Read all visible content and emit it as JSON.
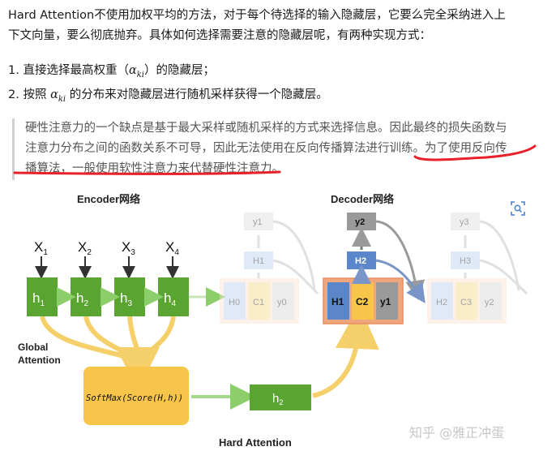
{
  "intro": {
    "line1": "Hard Attention不使用加权平均的方法，对于每个待选择的输入隐藏层，它要么完全采纳进入上",
    "line2": "下文向量，要么彻底抛弃。具体如何选择需要注意的隐藏层呢，有两种实现方式："
  },
  "list": {
    "item1_pre": "1. 直接选择最高权重（",
    "item1_math_base": "α",
    "item1_math_sub": "ki",
    "item1_post": "）的隐藏层；",
    "item2_pre": "2. 按照 ",
    "item2_math_base": "α",
    "item2_math_sub": "ki",
    "item2_post": " 的分布来对隐藏层进行随机采样获得一个隐藏层。"
  },
  "quote": {
    "line1": "硬性注意力的一个缺点是基于最大采样或随机采样的方式来选择信息。因此最终的损失函数与",
    "line2_a": "注意力分布之间的函数关系不可导，因此无法使用在反向传播算法进行训练。",
    "line2_b": "为了使用反向传",
    "line3": "播算法，一般使用软性注意力来代替硬性注意力。"
  },
  "diagram": {
    "encoder_title": "Encoder网络",
    "decoder_title": "Decoder网络",
    "x_base": "X",
    "x_subs": [
      "1",
      "2",
      "3",
      "4"
    ],
    "h_base": "h",
    "h_subs": [
      "1",
      "2",
      "3",
      "4"
    ],
    "global_attention_line1": "Global",
    "global_attention_line2": "Attention",
    "softmax_label": "SoftMax(Score(H,h))",
    "h2_base": "h",
    "h2_sub": "2",
    "hard_attention_label": "Hard Attention",
    "block0": {
      "cells": [
        "H0",
        "C1",
        "y0"
      ],
      "top": [
        "y1",
        "H1"
      ]
    },
    "block1": {
      "cells": [
        "H1",
        "C2",
        "y1"
      ],
      "top": [
        "y2",
        "H2"
      ]
    },
    "block2": {
      "cells": [
        "H2",
        "C3",
        "y2"
      ],
      "top": [
        "y3",
        "H3"
      ]
    }
  },
  "watermark": "知乎 @雅正冲蛋",
  "colors": {
    "green": "#5aa532",
    "orange": "#f6c54a",
    "red_underline": "#e8202a",
    "blue": "#5b86c9",
    "yellow_arrow": "#f5d06a"
  },
  "icons": {
    "zoom": "zoom-icon"
  }
}
